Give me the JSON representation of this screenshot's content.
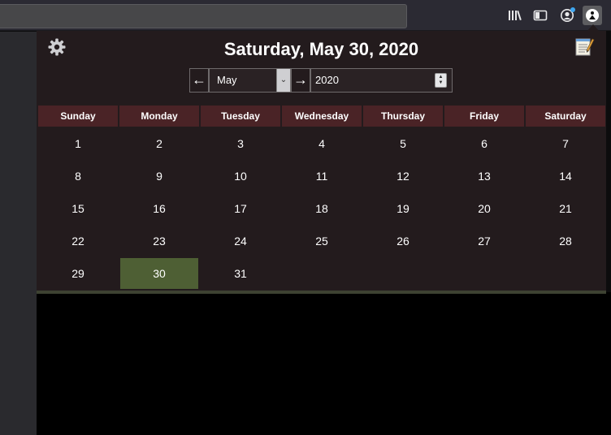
{
  "browser": {
    "toolbar_icons": [
      "library-icon",
      "sidebar-icon",
      "account-icon",
      "calendar-extension-icon"
    ]
  },
  "popup": {
    "title": "Saturday, May 30, 2020",
    "prev_label": "←",
    "next_label": "→",
    "month": "May",
    "year": "2020",
    "weekdays": [
      "Sunday",
      "Monday",
      "Tuesday",
      "Wednesday",
      "Thursday",
      "Friday",
      "Saturday"
    ],
    "weeks": [
      [
        "1",
        "2",
        "3",
        "4",
        "5",
        "6",
        "7"
      ],
      [
        "8",
        "9",
        "10",
        "11",
        "12",
        "13",
        "14"
      ],
      [
        "15",
        "16",
        "17",
        "18",
        "19",
        "20",
        "21"
      ],
      [
        "22",
        "23",
        "24",
        "25",
        "26",
        "27",
        "28"
      ],
      [
        "29",
        "30",
        "31",
        "",
        "",
        "",
        ""
      ]
    ],
    "selected_day": "30",
    "colors": {
      "background": "#231b1d",
      "header": "#4a2326",
      "selected": "#4e5f34"
    }
  }
}
